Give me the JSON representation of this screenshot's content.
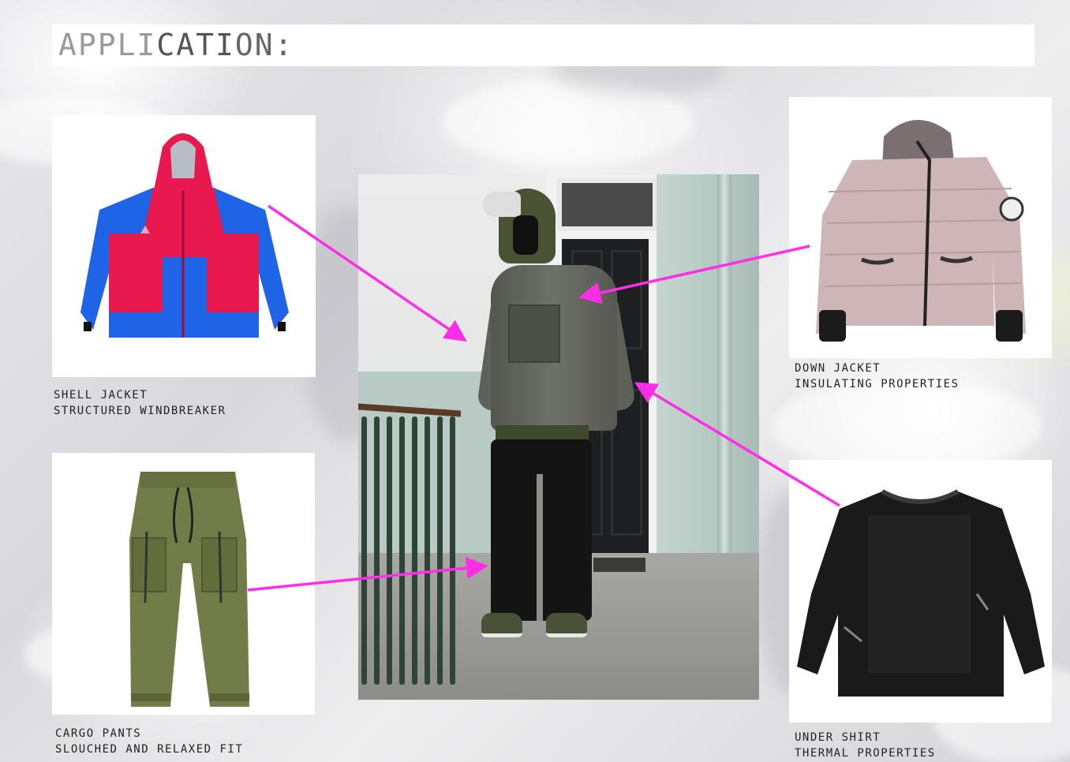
{
  "title": {
    "light": "APPLI",
    "dark": "CATI",
    "light2": "ON:"
  },
  "items": {
    "shell_jacket": {
      "line1": "SHELL JACKET",
      "line2": "STRUCTURED WINDBREAKER"
    },
    "cargo_pants": {
      "line1": "CARGO PANTS",
      "line2": "SLOUCHED AND RELAXED FIT"
    },
    "down_jacket": {
      "line1": "DOWN JACKET",
      "line2": "INSULATING PROPERTIES"
    },
    "under_shirt": {
      "line1": "UNDER SHIRT",
      "line2": "THERMAL PROPERTIES"
    }
  },
  "colors": {
    "arrow": "#ff2ee6",
    "shell_red": "#e8194f",
    "shell_blue": "#1f63e6",
    "pants_olive": "#717c49",
    "down_mauve": "#cdb5b8",
    "shirt_black": "#1a1a1a"
  },
  "icons": [
    "shell-jacket-image",
    "cargo-pants-image",
    "down-jacket-image",
    "under-shirt-image",
    "model-photo"
  ]
}
